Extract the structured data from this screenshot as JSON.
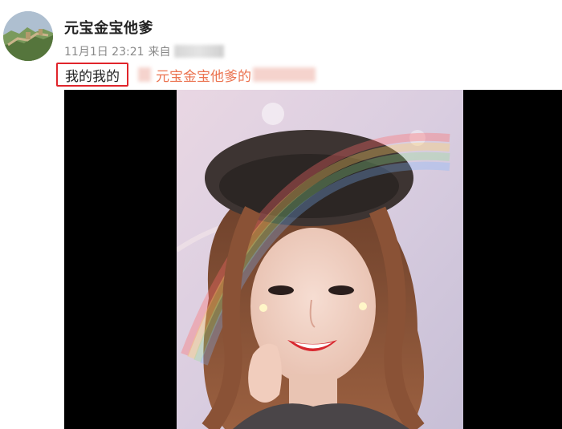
{
  "post": {
    "username": "元宝金宝他爹",
    "timestamp": "11月1日 23:21",
    "source_prefix": "来自",
    "text": "我的我的",
    "mention": "元宝金宝他爹的",
    "highlight_color": "#e0242b",
    "mention_color": "#eb7350"
  },
  "media": {
    "type": "photo",
    "icon": "photo-selfie"
  }
}
